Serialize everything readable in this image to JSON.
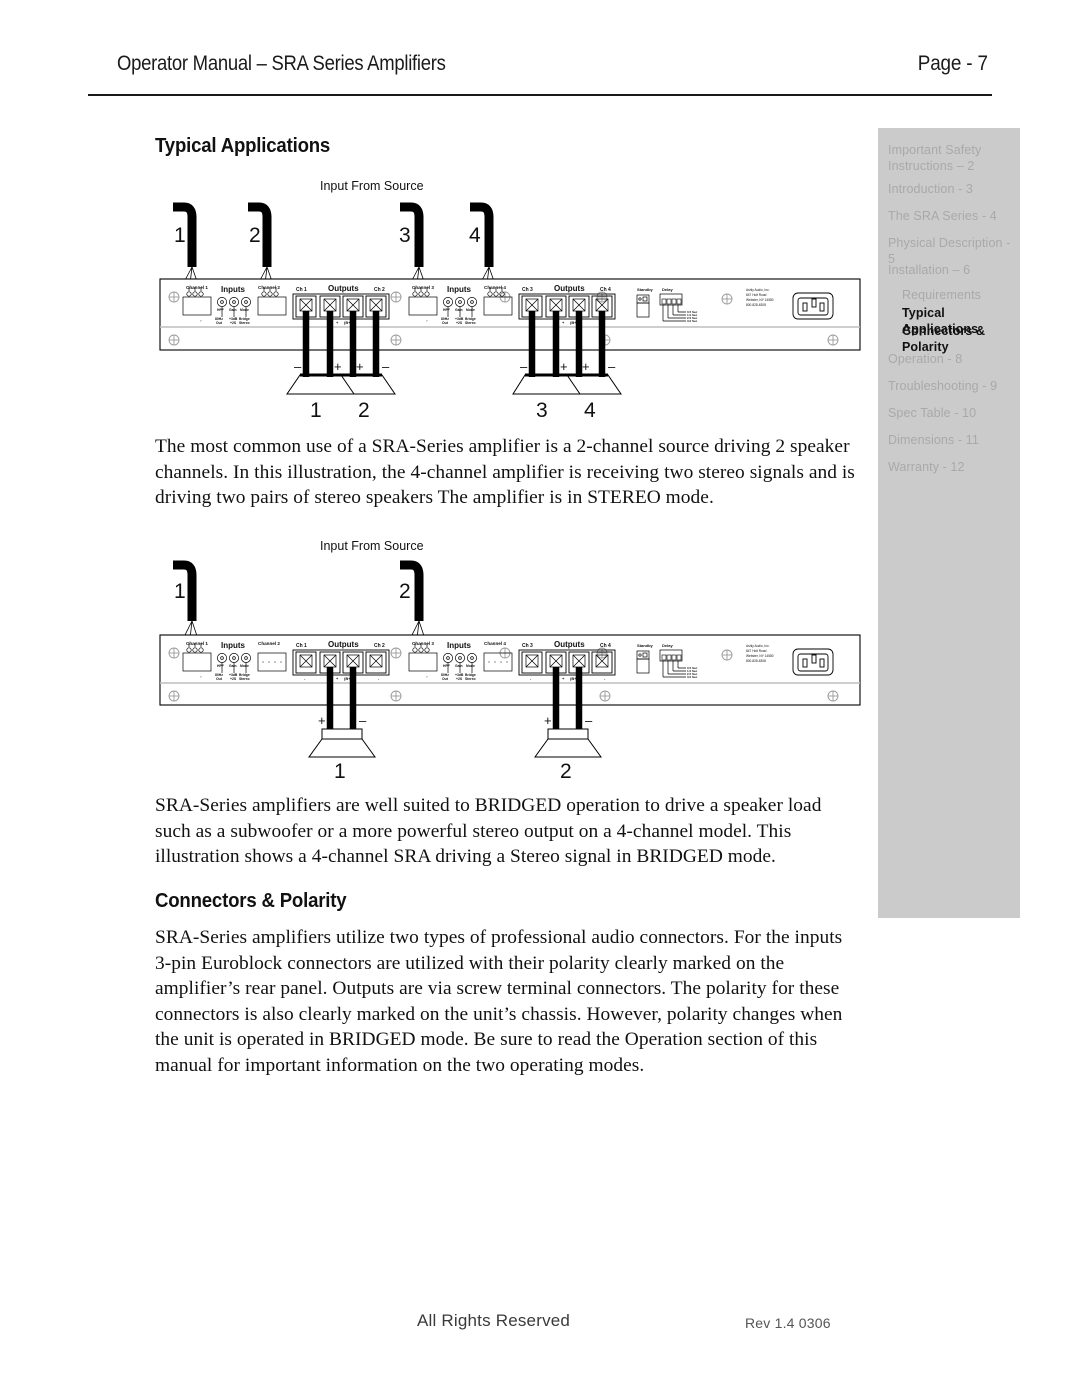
{
  "header": {
    "title": "Operator Manual – SRA Series Amplifiers",
    "page_label": "Page - 7"
  },
  "sidebar": {
    "items": [
      {
        "label": "Important Safety\nInstructions – 2",
        "active": false,
        "sub": false
      },
      {
        "label": "Introduction - 3",
        "active": false,
        "sub": false
      },
      {
        "label": "The SRA Series - 4",
        "active": false,
        "sub": false
      },
      {
        "label": "Physical Description - 5",
        "active": false,
        "sub": false
      },
      {
        "label": "Installation – 6",
        "active": false,
        "sub": false
      },
      {
        "label": "Requirements",
        "active": false,
        "sub": true
      },
      {
        "label": "Typical Applications",
        "active": true,
        "sub": true
      },
      {
        "label": "Connectors & Polarity",
        "active": true,
        "sub": true
      },
      {
        "label": "Operation - 8",
        "active": false,
        "sub": false
      },
      {
        "label": "Troubleshooting - 9",
        "active": false,
        "sub": false
      },
      {
        "label": "Spec Table - 10",
        "active": false,
        "sub": false
      },
      {
        "label": "Dimensions - 11",
        "active": false,
        "sub": false
      },
      {
        "label": "Warranty - 12",
        "active": false,
        "sub": false
      }
    ]
  },
  "sections": {
    "typical_applications_heading": "Typical Applications",
    "connectors_polarity_heading": "Connectors & Polarity",
    "paragraph_stereo": "The most common use of a SRA-Series amplifier is a 2-channel source driving 2 speaker channels.  In this illustration, the 4-channel amplifier is receiving two stereo signals and is driving two pairs of stereo speakers The amplifier is in STEREO mode.",
    "paragraph_bridged": "SRA-Series amplifiers are well suited to BRIDGED operation to drive a speaker load such as a subwoofer or a more powerful stereo output on a 4-channel model.  This illustration shows a 4-channel SRA driving a Stereo signal in BRIDGED mode.",
    "paragraph_connectors": "SRA-Series amplifiers utilize two types of professional audio connectors.  For the inputs 3-pin Euroblock connectors are utilized with their polarity clearly marked on the amplifier’s rear panel.  Outputs are via screw terminal connectors.  The polarity for these connectors is also clearly marked on the unit’s chassis.  However, polarity changes when the unit is operated in BRIDGED mode.  Be sure to read the Operation section of this manual for important information on the two operating modes."
  },
  "diagram_stereo": {
    "caption": "Input From Source",
    "input_cable_labels": [
      "1",
      "2",
      "3",
      "4"
    ],
    "speaker_labels": [
      "1",
      "2",
      "3",
      "4"
    ],
    "polarity_marks": [
      "–",
      "+",
      "+",
      "–",
      "–",
      "+",
      "+",
      "–"
    ],
    "panel": {
      "input_blocks": [
        "Channel 1",
        "Channel 2",
        "Channel 3",
        "Channel 4"
      ],
      "inputs_label": "Inputs",
      "outputs_label": "Outputs",
      "output_channel_labels": [
        "Ch 1",
        "Ch 2",
        "Ch 3",
        "Ch 4"
      ],
      "knob_labels": [
        "HPF",
        "Gain",
        "Mode"
      ],
      "knob_sub_labels": [
        [
          "80Hz",
          "Out"
        ],
        [
          "+3dB",
          "+2S"
        ],
        [
          "Bridge",
          "Stereo"
        ]
      ],
      "standby_label": "Standby",
      "delay_label": "Delay",
      "delay_options": [
        "0.5 Sec",
        "1.0 Sec",
        "2.0 Sec",
        "3.0 Sec"
      ],
      "brand_address": [
        "Ashly Audio, Inc.",
        "847 Holt Road",
        "Webster, NY 14580",
        "800-828-6308"
      ],
      "output_polarity_print": "+ (B+)"
    }
  },
  "diagram_bridged": {
    "caption": "Input From Source",
    "input_cable_labels": [
      "1",
      "2"
    ],
    "speaker_labels": [
      "1",
      "2"
    ],
    "polarity_marks": [
      "+",
      "–",
      "+",
      "–"
    ],
    "panel": {
      "input_blocks": [
        "Channel 1",
        "Channel 2",
        "Channel 3",
        "Channel 4"
      ],
      "inputs_label": "Inputs",
      "outputs_label": "Outputs",
      "output_channel_labels": [
        "Ch 1",
        "Ch 2",
        "Ch 3",
        "Ch 4"
      ],
      "knob_labels": [
        "HPF",
        "Gain",
        "Mode"
      ],
      "standby_label": "Standby",
      "delay_label": "Delay"
    }
  },
  "footer": {
    "left": "All Rights Reserved",
    "right": "Rev 1.4 0306"
  }
}
